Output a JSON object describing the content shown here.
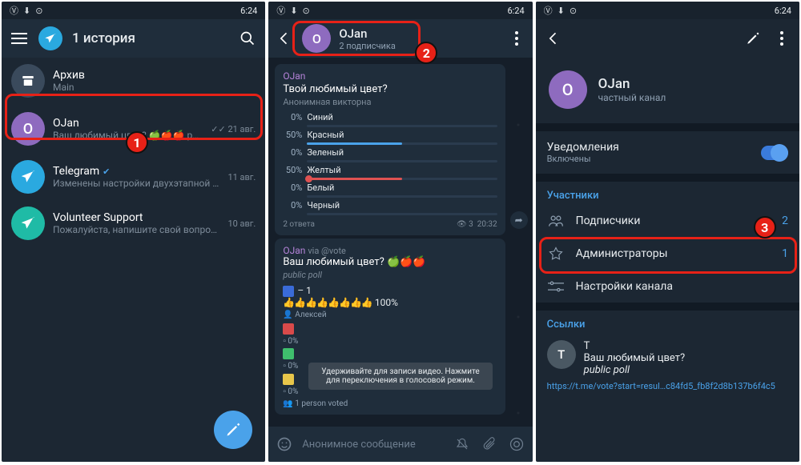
{
  "status_time": "6:24",
  "panel1": {
    "title": "1 история",
    "archive": "Архив",
    "archive_sub": "Main",
    "chats": [
      {
        "name": "OJan",
        "sub": "Ваш любимый цвет? 🍏🍎🍎 public poll 🟦 –…",
        "date": "21 авг."
      },
      {
        "name": "Telegram",
        "sub": "Изменены настройки двухэтапной аутентиф…",
        "date": "11 авг."
      },
      {
        "name": "Volunteer Support",
        "sub": "Пожалуйста, напишите свой вопрос новым с…",
        "date": "10 авг."
      }
    ]
  },
  "panel2": {
    "name": "OJan",
    "subscribers": "2 подписчика",
    "poll1": {
      "author": "OJan",
      "title": "Твой любимый цвет?",
      "sub": "Анонимная викторна",
      "options": [
        {
          "pct": "0%",
          "label": "Синий",
          "fill": 0,
          "color": "#4aa2ea"
        },
        {
          "pct": "50%",
          "label": "Красный",
          "fill": 50,
          "color": "#4aa2ea"
        },
        {
          "pct": "0%",
          "label": "Зеленый",
          "fill": 0,
          "color": "#4aa2ea"
        },
        {
          "pct": "50%",
          "label": "Желтый",
          "fill": 50,
          "color": "#e05252",
          "dot": true
        },
        {
          "pct": "0%",
          "label": "Белый",
          "fill": 0,
          "color": "#4aa2ea"
        },
        {
          "pct": "0%",
          "label": "Черный",
          "fill": 0,
          "color": "#4aa2ea"
        }
      ],
      "answers": "2 ответа",
      "views": "3",
      "time": "20:32"
    },
    "poll2": {
      "author": "OJan",
      "via": "via @vote",
      "title": "Ваш любимый цвет? 🍏🍎🍎",
      "sub": "public poll",
      "row1_label": "– 1",
      "row1_pct": "100%",
      "row1_name": "Алексей",
      "rows": [
        "0%",
        "0%",
        "0%"
      ],
      "voted": "1 person voted"
    },
    "tooltip": "Удерживайте для записи видео. Нажмите для переключения в голосовой режим.",
    "placeholder": "Анонимное сообщение"
  },
  "panel3": {
    "name": "OJan",
    "type": "частный канал",
    "notif": "Уведомления",
    "notif_sub": "Включены",
    "members_head": "Участники",
    "subs_label": "Подписчики",
    "subs_val": "2",
    "admins_label": "Администраторы",
    "admins_val": "1",
    "settings_label": "Настройки канала",
    "links_head": "Ссылки",
    "link_title": "T",
    "link_sub1": "Ваш любимый цвет?",
    "link_sub2": "public poll",
    "link_url": "https://t.me/vote?start=resul…c84fd5_fb8f2d8b137b6f4c5"
  },
  "step1": "1",
  "step2": "2",
  "step3": "3"
}
